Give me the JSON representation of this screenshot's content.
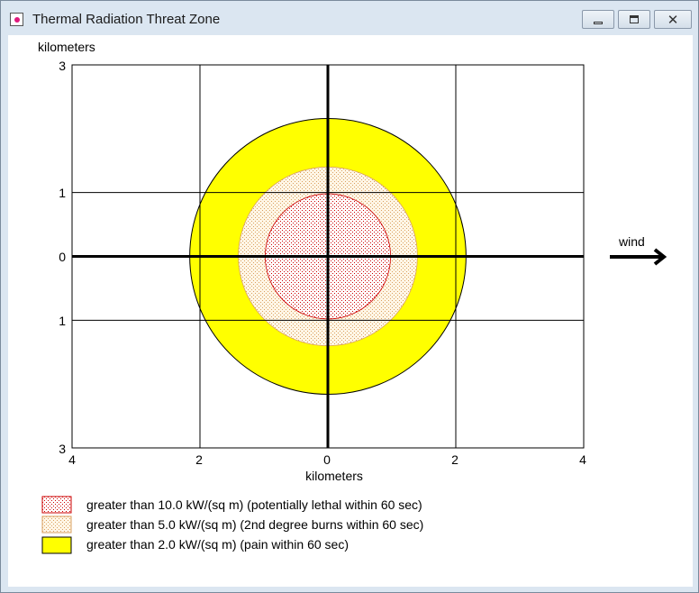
{
  "window": {
    "title": "Thermal Radiation Threat Zone",
    "controls": {
      "minimize": "minimize",
      "maximize": "maximize",
      "close": "close"
    }
  },
  "plot": {
    "ylabel": "kilometers",
    "xlabel": "kilometers",
    "y_ticks": [
      "3",
      "1",
      "0",
      "1",
      "3"
    ],
    "x_ticks": [
      "4",
      "2",
      "0",
      "2",
      "4"
    ],
    "wind_label": "wind"
  },
  "legend": {
    "items": [
      {
        "label": "greater than 10.0 kW/(sq m) (potentially lethal within 60 sec)",
        "color": "#cc0000"
      },
      {
        "label": "greater than 5.0 kW/(sq m) (2nd degree burns within 60 sec)",
        "color": "#e8a060"
      },
      {
        "label": "greater than 2.0 kW/(sq m) (pain within 60 sec)",
        "color": "#ffff00"
      }
    ]
  },
  "chart_data": {
    "type": "area",
    "xlabel": "kilometers",
    "ylabel": "kilometers",
    "xlim": [
      -4,
      4
    ],
    "ylim": [
      -3,
      3
    ],
    "zones": [
      {
        "name": "greater than 10.0 kW/(sq m) (potentially lethal within 60 sec)",
        "radius_km": 0.98,
        "fill": "#ffffff",
        "pattern_color": "#cc0000"
      },
      {
        "name": "greater than 5.0 kW/(sq m) (2nd degree burns within 60 sec)",
        "radius_km": 1.4,
        "fill": "#fff3dc",
        "pattern_color": "#d9a060"
      },
      {
        "name": "greater than 2.0 kW/(sq m) (pain within 60 sec)",
        "radius_km": 2.16,
        "fill": "#ffff00",
        "pattern_color": "#ffff00"
      }
    ],
    "grid": true
  }
}
